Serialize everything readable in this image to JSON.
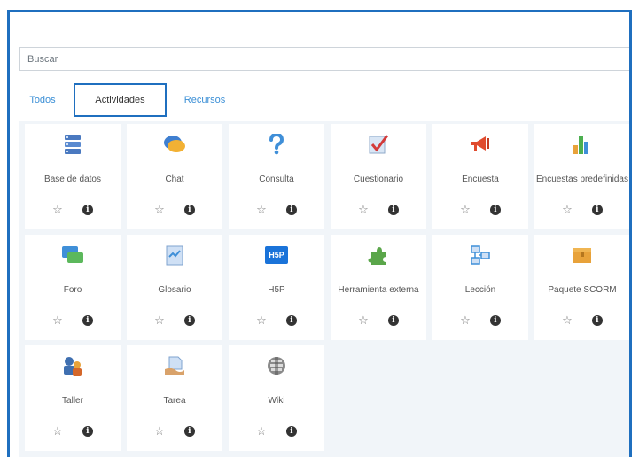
{
  "search": {
    "placeholder": "Buscar"
  },
  "tabs": [
    {
      "label": "Todos"
    },
    {
      "label": "Actividades"
    },
    {
      "label": "Recursos"
    }
  ],
  "tiles": [
    {
      "label": "Base de datos",
      "icon": "database-icon"
    },
    {
      "label": "Chat",
      "icon": "chat-icon"
    },
    {
      "label": "Consulta",
      "icon": "question-icon"
    },
    {
      "label": "Cuestionario",
      "icon": "quiz-icon"
    },
    {
      "label": "Encuesta",
      "icon": "megaphone-icon"
    },
    {
      "label": "Encuestas predefinidas",
      "icon": "bar-chart-icon"
    },
    {
      "label": "Foro",
      "icon": "forum-icon"
    },
    {
      "label": "Glosario",
      "icon": "glossary-icon"
    },
    {
      "label": "H5P",
      "icon": "h5p-icon"
    },
    {
      "label": "Herramienta externa",
      "icon": "puzzle-icon"
    },
    {
      "label": "Lección",
      "icon": "lesson-icon"
    },
    {
      "label": "Paquete SCORM",
      "icon": "scorm-package-icon"
    },
    {
      "label": "Taller",
      "icon": "workshop-icon"
    },
    {
      "label": "Tarea",
      "icon": "assignment-icon"
    },
    {
      "label": "Wiki",
      "icon": "wiki-icon"
    }
  ],
  "h5p_text": "H5P",
  "info_glyph": "i",
  "star_glyph": "☆"
}
